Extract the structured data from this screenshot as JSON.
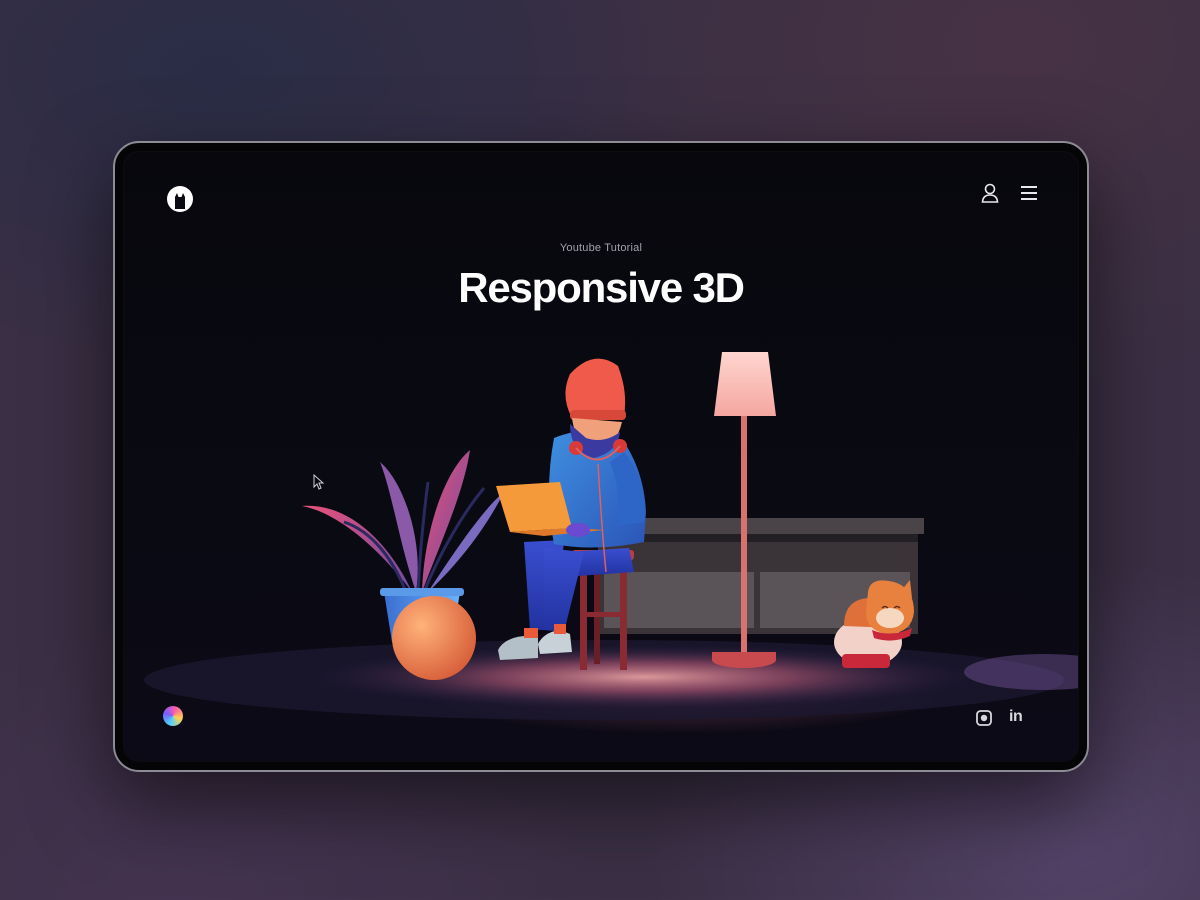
{
  "hero": {
    "eyebrow": "Youtube Tutorial",
    "title": "Responsive 3D"
  },
  "header": {
    "logo_icon": "cat-logo-icon",
    "user_icon": "user-icon",
    "menu_icon": "hamburger-menu-icon"
  },
  "footer": {
    "theme_icon": "color-wheel-icon",
    "social": {
      "instagram_icon": "instagram-icon",
      "linkedin_label": "in"
    }
  },
  "colors": {
    "background": "#0a0a13",
    "text": "#ffffff",
    "accent_pink": "#e8667a",
    "accent_orange": "#f08a3a",
    "accent_blue": "#3f6fd8"
  }
}
